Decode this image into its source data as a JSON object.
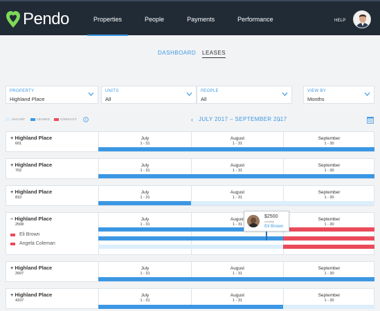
{
  "app": {
    "name": "Pendo"
  },
  "nav": {
    "items": [
      "Properties",
      "People",
      "Payments",
      "Performance"
    ],
    "active": "Properties",
    "help_label": "HELP"
  },
  "subtabs": {
    "dashboard": "DASHBOARD",
    "leases": "LEASES",
    "active": "LEASES"
  },
  "filters": {
    "property": {
      "label": "PROPERTY",
      "value": "Highland Place"
    },
    "units": {
      "label": "UNITS",
      "value": "All"
    },
    "people": {
      "label": "PEOPLE",
      "value": "All"
    },
    "view_by": {
      "label": "VIEW BY",
      "value": "Months"
    }
  },
  "legend": {
    "vacant": "VACANT",
    "leased": "LEASED",
    "conflict": "CONFLICT"
  },
  "colors": {
    "leased": "#3b97e3",
    "vacant": "#dceefb",
    "conflict": "#ea4a5a",
    "header_bg": "#212b36",
    "accent": "#3b97e3"
  },
  "period": {
    "label": "JULY 2017 – SEPTEMBER 2017",
    "prev": "‹",
    "next": "›"
  },
  "months": [
    {
      "name": "July",
      "range": "1 - 31"
    },
    {
      "name": "August",
      "range": "1 - 31"
    },
    {
      "name": "September",
      "range": "1 - 30"
    }
  ],
  "units": [
    {
      "property": "+ Highland Place",
      "unit": "601"
    },
    {
      "property": "+ Highland Place",
      "unit": "702"
    },
    {
      "property": "+ Highland Place",
      "unit": "810"
    },
    {
      "property": "– Highland Place",
      "unit": "2508",
      "tenants": [
        {
          "name": "Eli Brown"
        },
        {
          "name": "Angela Coleman"
        }
      ]
    },
    {
      "property": "+ Highland Place",
      "unit": "2607"
    },
    {
      "property": "+ Highland Place",
      "unit": "4107"
    }
  ],
  "tooltip": {
    "amount": "$2500",
    "period": "monthly",
    "name": "Eli Brown"
  }
}
